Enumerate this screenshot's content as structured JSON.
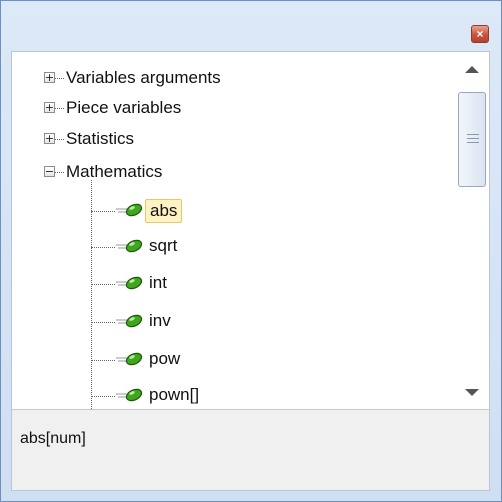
{
  "window": {
    "close_symbol": "×"
  },
  "tree": {
    "categories": [
      {
        "label": "Variables arguments",
        "expander": "+"
      },
      {
        "label": "Piece variables",
        "expander": "+"
      },
      {
        "label": "Statistics",
        "expander": "+"
      },
      {
        "label": "Mathematics",
        "expander": "−"
      }
    ],
    "functions": [
      {
        "label": "abs",
        "selected": true
      },
      {
        "label": "sqrt"
      },
      {
        "label": "int"
      },
      {
        "label": "inv"
      },
      {
        "label": "pow"
      },
      {
        "label": "pown[]"
      }
    ]
  },
  "description": {
    "text": "abs[num]"
  },
  "colors": {
    "selection_background": "#fff3c4",
    "function_icon": "#3fa61d",
    "close_button": "#c8533c"
  }
}
